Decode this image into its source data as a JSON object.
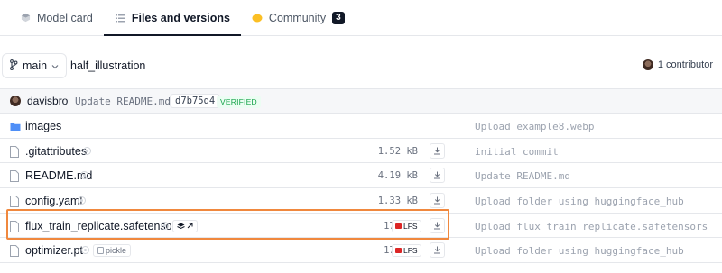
{
  "tabs": [
    {
      "label": "Model card",
      "icon": "model-card-icon"
    },
    {
      "label": "Files and versions",
      "icon": "files-icon",
      "active": true
    },
    {
      "label": "Community",
      "icon": "community-icon",
      "count": "3"
    }
  ],
  "branch": {
    "name": "main",
    "path": "half_illustration"
  },
  "contributors": {
    "label": "1 contributor"
  },
  "commit": {
    "user": "davisbro",
    "message": "Update README.md",
    "hash": "d7b75d4",
    "status": "VERIFIED"
  },
  "files": [
    {
      "name": "images",
      "type": "folder",
      "size": "",
      "lfs": false,
      "last_commit": "Upload example8.webp"
    },
    {
      "name": ".gitattributes",
      "type": "file",
      "size": "1.52 kB",
      "lfs": false,
      "last_commit": "initial commit"
    },
    {
      "name": "README.md",
      "type": "file",
      "size": "4.19 kB",
      "lfs": false,
      "last_commit": "Update README.md"
    },
    {
      "name": "config.yaml",
      "type": "file",
      "size": "1.33 kB",
      "lfs": false,
      "last_commit": "Upload folder using huggingface_hub"
    },
    {
      "name": "flux_train_replicate.safetensors",
      "type": "file",
      "size": "172 MB",
      "lfs": true,
      "lfs_label": "LFS",
      "last_commit": "Upload flux_train_replicate.safetensors"
    },
    {
      "name": "optimizer.pt",
      "type": "file",
      "size": "173 MB",
      "lfs": true,
      "lfs_label": "LFS",
      "tag": "pickle",
      "last_commit": "Upload folder using huggingface_hub"
    }
  ],
  "colors": {
    "highlight": "#f0883e",
    "folder": "#4f8ff7",
    "verified": "#16a34a",
    "lfs": "#dc2626"
  }
}
